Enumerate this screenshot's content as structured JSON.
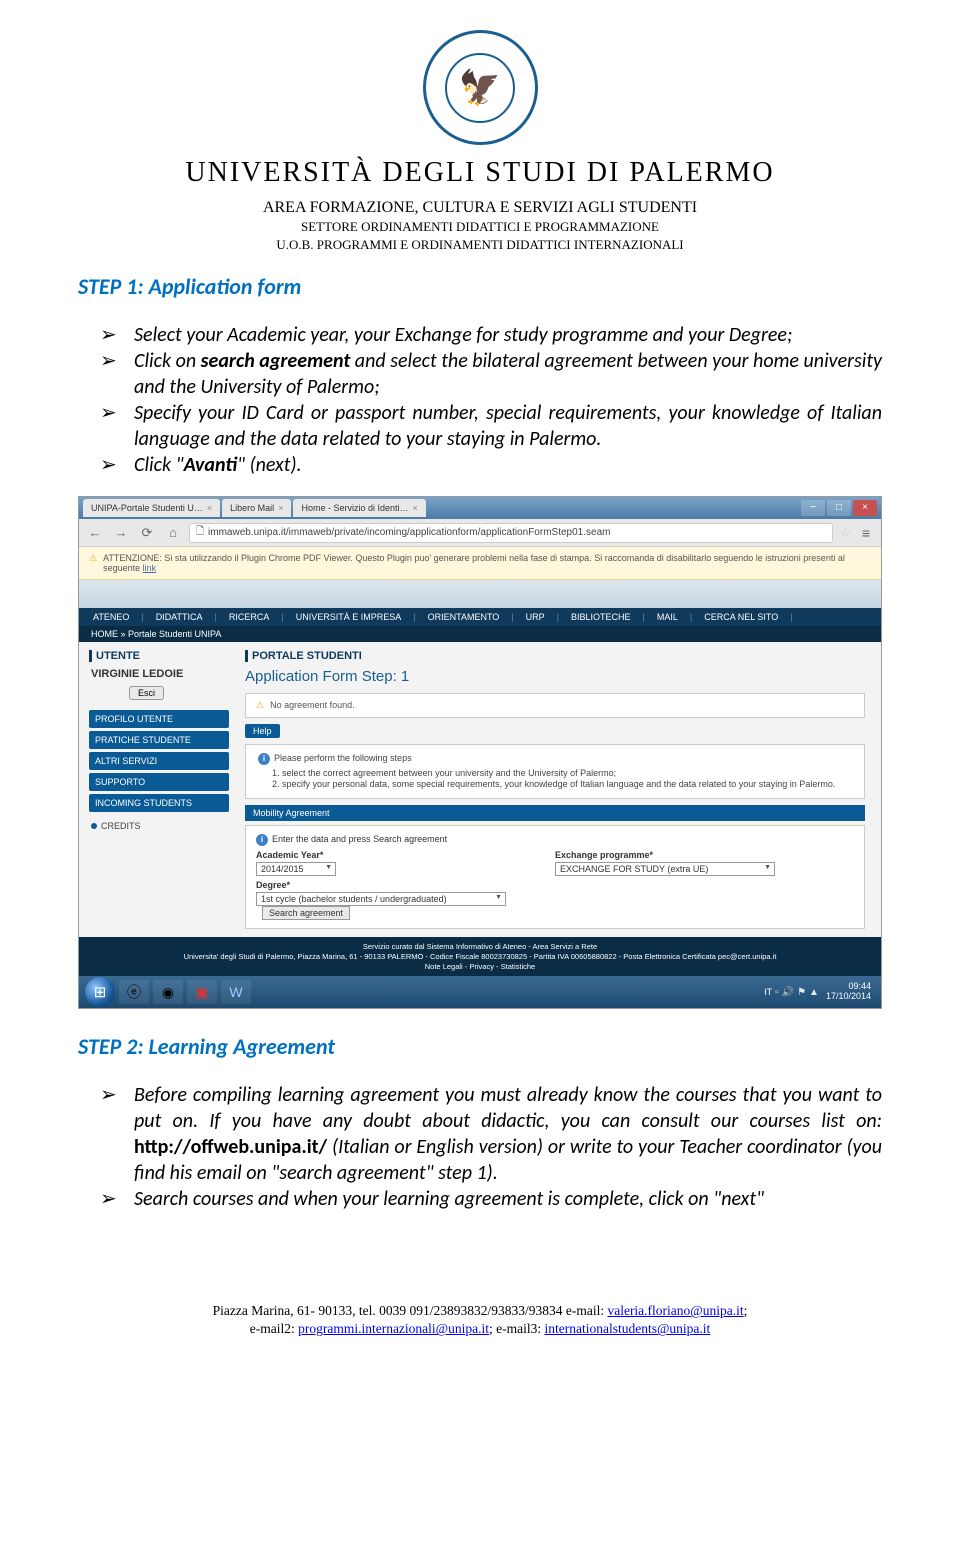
{
  "header": {
    "university_name": "UNIVERSITÀ DEGLI STUDI DI PALERMO",
    "line1": "AREA FORMAZIONE, CULTURA E SERVIZI AGLI STUDENTI",
    "line2": "SETTORE ORDINAMENTI DIDATTICI E PROGRAMMAZIONE",
    "line3": "U.O.B. PROGRAMMI E ORDINAMENTI DIDATTICI INTERNAZIONALI"
  },
  "step1": {
    "title": "STEP 1: Application form",
    "b1_a": "Select your Academic year, your Exchange for study programme and your Degree;",
    "b2_a": "Click on ",
    "b2_agreement": "search agreement",
    "b2_b": " and select the bilateral agreement between your home university and the University of Palermo;",
    "b3": "Specify your ID Card or passport number, special requirements, your knowledge of Italian language and the data related to your staying in Palermo.",
    "b4_a": "Click \"",
    "b4_avanti": "Avanti",
    "b4_b": "\" (next)."
  },
  "screenshot": {
    "tabs": [
      "UNIPA-Portale Studenti U…",
      "Libero Mail",
      "Home - Servizio di Identi…"
    ],
    "url": "immaweb.unipa.it/immaweb/private/incoming/applicationform/applicationFormStep01.seam",
    "warning_a": "ATTENZIONE: Si sta utilizzando il Plugin Chrome PDF Viewer. Questo Plugin puo' generare problemi nella fase di stampa. Si raccomanda di disabilitarlo seguendo le istruzioni presenti al seguente ",
    "warning_link": "link",
    "topnav": [
      "ATENEO",
      "DIDATTICA",
      "RICERCA",
      "UNIVERSITÀ E IMPRESA",
      "ORIENTAMENTO",
      "URP",
      "BIBLIOTECHE",
      "MAIL",
      "CERCA NEL SITO"
    ],
    "breadcrumb": "HOME » Portale Studenti UNIPA",
    "left": {
      "utente": "UTENTE",
      "user_name": "VIRGINIE LEDOIE",
      "esci": "Esci",
      "items": [
        "PROFILO UTENTE",
        "PRATICHE STUDENTE",
        "ALTRI SERVIZI",
        "SUPPORTO",
        "INCOMING STUDENTS"
      ],
      "credits": "CREDITS"
    },
    "right": {
      "portale": "PORTALE STUDENTI",
      "form_title": "Application Form Step: 1",
      "no_agreement": "No agreement found.",
      "help": "Help",
      "please": "Please perform the following steps",
      "li1": "select the correct agreement between your university and the University of Palermo;",
      "li2": "specify your personal data, some special requirements, your knowledge of Italian language and the data related to your staying in Palermo.",
      "mobility": "Mobility Agreement",
      "enter": "Enter the data and press Search agreement",
      "academic_year_label": "Academic Year*",
      "academic_year_value": "2014/2015",
      "exchange_label": "Exchange programme*",
      "exchange_value": "EXCHANGE FOR STUDY (extra UE)",
      "degree_label": "Degree*",
      "degree_value": "1st cycle (bachelor students / undergraduated)",
      "search_btn": "Search agreement"
    },
    "footer_l1": "Servizio curato dal Sistema Informativo di Ateneo - Area Servizi a Rete",
    "footer_l2": "Universita' degli Studi di Palermo, Piazza Marina, 61 - 90133 PALERMO - Codice Fiscale 80023730825 - Partita IVA 00605880822 - Posta Elettronica Certificata pec@cert.unipa.it",
    "footer_l3": "Note Legali - Privacy - Statistiche",
    "lang": "IT",
    "time": "09:44",
    "date": "17/10/2014"
  },
  "step2": {
    "title": "STEP 2: Learning Agreement",
    "b1_a": "Before compiling learning agreement you must already know the courses that you want to put on. If you have any doubt about didactic, you can consult our courses list on: ",
    "b1_url": "http://offweb.unipa.it/",
    "b1_b": " (Italian or English version) or write to your Teacher coordinator (you find his email on \"search agreement\" step 1).",
    "b2": " Search courses and when your learning agreement is complete, click on \"next\""
  },
  "footer": {
    "l1_a": "Piazza Marina, 61- 90133, tel. 0039 091/23893832/93833/93834 e-mail: ",
    "l1_link": "valeria.floriano@unipa.it",
    "l1_b": ";",
    "l2_a": "e-mail2: ",
    "l2_link1": "programmi.internazionali@unipa.it",
    "l2_b": "; e-mail3: ",
    "l2_link2": "internationalstudents@unipa.it"
  }
}
